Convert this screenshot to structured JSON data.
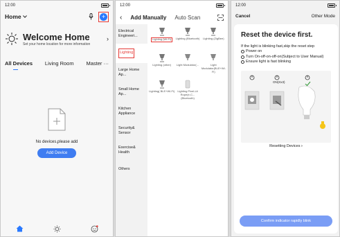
{
  "colors": {
    "accent": "#2979ff",
    "highlight": "#e53935",
    "button": "#3f7df1",
    "confirm": "#7a9df5"
  },
  "panel1": {
    "status_time": "12:00",
    "home_select": "Home",
    "welcome_title": "Welcome Home",
    "welcome_sub": "Set your home location for more information",
    "tabs": [
      "All Devices",
      "Living Room",
      "Master"
    ],
    "empty_message": "No devices,please add",
    "add_button": "Add Device",
    "icons": [
      "chevron-down-icon",
      "mic-icon",
      "plus-icon",
      "sun-icon",
      "more-icon",
      "empty-file-icon",
      "home-icon",
      "smart-icon",
      "profile-icon"
    ]
  },
  "panel2": {
    "status_time": "12:00",
    "tab_manual": "Add Manually",
    "tab_scan": "Auto Scan",
    "categories": [
      "Electrical Engineeri...",
      "Lighting",
      "Large Home Ap...",
      "Small Home Ap...",
      "Kitchen Appliance",
      "Security& Sensor",
      "Exercise& Health",
      "Others"
    ],
    "devices": [
      "Lighting (Wi-Fi)",
      "Lighting (Bluetooth)",
      "Lighting (ZigBee)",
      "Lighting (other)",
      "Light Modulator(...",
      "Light Modulator(BLE+Wi-Fi)",
      "Lighting( BLE+Wi-Fi)",
      "Lighting Pixel-Lit Rope(e-C... (Bluetooth)"
    ]
  },
  "panel3": {
    "status_time": "12:00",
    "cancel": "Cancel",
    "other_mode": "Other Mode",
    "title": "Reset the device first.",
    "intro": "If the light is blinking fast,skip the reset step",
    "steps": [
      "Power on",
      "Turn On-off-on-off-on(Subject to User Manual)",
      "Ensure light is fast blinking"
    ],
    "illus_label": "ON(Xx3)",
    "resetting": "Resetting Devices",
    "confirm": "Confirm indicator rapidly blink"
  }
}
